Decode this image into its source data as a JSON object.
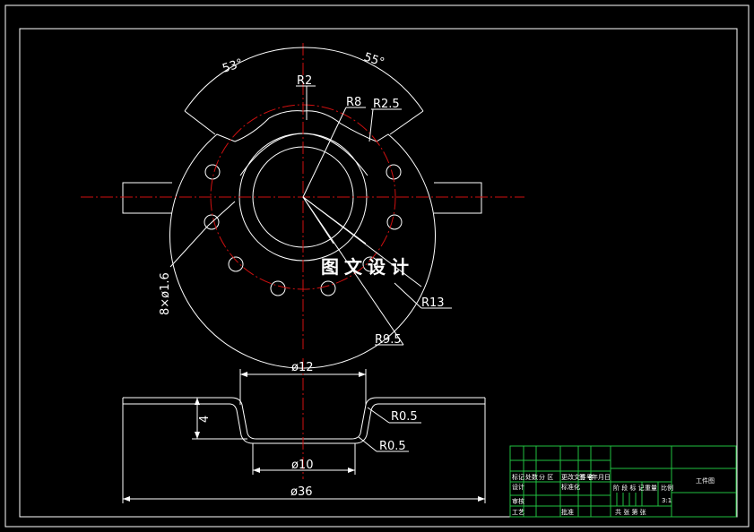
{
  "colors": {
    "background": "#000000",
    "outline": "#ffffff",
    "centerline": "#d01010",
    "title_block": "#20c040"
  },
  "top_view": {
    "angle_left": "53°",
    "angle_right": "55°",
    "radius_r2": "R2",
    "radius_r8": "R8",
    "radius_r2_5": "R2.5",
    "radius_r13": "R13",
    "radius_r9_5": "R9.5",
    "holes_note": "8×ø1.6"
  },
  "section_view": {
    "dia_top": "ø12",
    "dia_bottom": "ø10",
    "dia_overall": "ø36",
    "depth": "4",
    "fillet_upper": "R0.5",
    "fillet_lower": "R0.5"
  },
  "watermark": "图文设计",
  "title_block": {
    "row1": [
      "标记",
      "处数",
      "分 区",
      "更改文件号",
      "签 名",
      "年月日"
    ],
    "row2": [
      "设计",
      "",
      "",
      "标准化",
      "",
      ""
    ],
    "row3": [
      "审核",
      "",
      "",
      "",
      "",
      ""
    ],
    "row4": [
      "工艺",
      "",
      "",
      "批准",
      "",
      ""
    ],
    "stage_headers": [
      "阶 段 标 记",
      "重量",
      "比例"
    ],
    "scale_value": "3:1",
    "sheet_info": "共 张  第 张",
    "part_name": "工件图"
  }
}
